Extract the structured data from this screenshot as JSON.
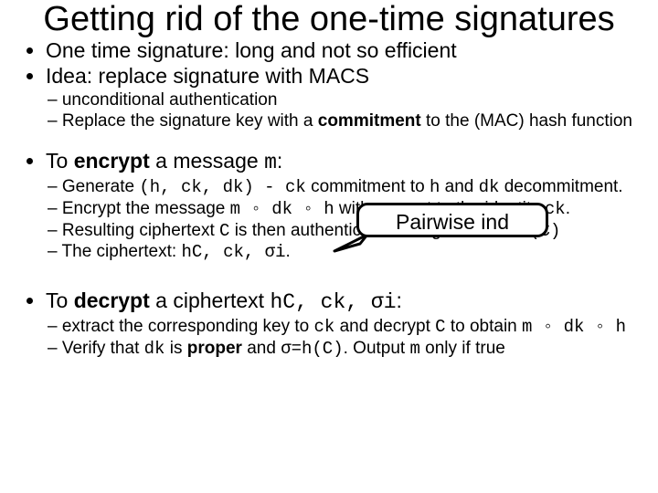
{
  "title": "Getting rid of the one-time signatures",
  "bullets": {
    "b1": "One time signature: long and not so efficient",
    "b2": "Idea: replace signature with MACS",
    "b2_sub": {
      "s1": "unconditional authentication",
      "s2_a": "Replace the signature key with a ",
      "s2_b": "commitment",
      "s2_c": " to the (MAC) hash function"
    },
    "b3_a": "To ",
    "b3_b": "encrypt",
    "b3_c": " a message ",
    "b3_d": "m",
    "b3_e": ":",
    "b3_sub": {
      "s1_a": "Generate  ",
      "s1_b": "(h, ck, dk) - ck",
      "s1_c": " commitment to ",
      "s1_d": "h",
      "s1_e": " and ",
      "s1_f": "dk",
      "s1_g": " decommitment.",
      "s2_a": "Encrypt the message ",
      "s2_b": "m ◦ dk ◦ h",
      "s2_c": " with respect to the identity ",
      "s2_d": "ck",
      "s2_e": ".",
      "s3_a": "Resulting ciphertext ",
      "s3_b": "C",
      "s3_c": " is then authenticated using ",
      "s3_d": "h:  σ = h(C)",
      "s4_a": "The ciphertext: ",
      "s4_b": "hC, ck, σi",
      "s4_c": "."
    },
    "b4_a": "To ",
    "b4_b": "decrypt",
    "b4_c": " a ciphertext ",
    "b4_d": "hC, ck, σi",
    "b4_e": ":",
    "b4_sub": {
      "s1_a": "extract the corresponding key to ",
      "s1_b": "ck",
      "s1_c": " and decrypt ",
      "s1_d": "C",
      "s1_e": " to obtain ",
      "s1_f": "m ◦ dk ◦ h",
      "s2_a": "Verify that ",
      "s2_b": "dk",
      "s2_c": " is ",
      "s2_d": "proper",
      "s2_e": " and ",
      "s2_f": "σ=h(C)",
      "s2_g": ". Output ",
      "s2_h": "m",
      "s2_i": " only if true"
    }
  },
  "callout": "Pairwise ind"
}
